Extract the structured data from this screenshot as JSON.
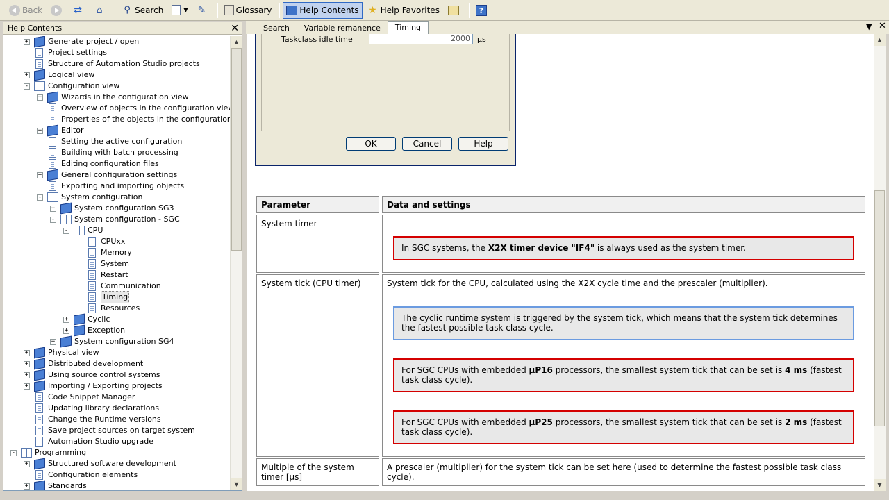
{
  "toolbar": {
    "back": "Back",
    "search": "Search",
    "glossary": "Glossary",
    "help_contents": "Help Contents",
    "help_favorites": "Help Favorites"
  },
  "left_panel": {
    "title": "Help Contents",
    "close": "✕"
  },
  "tree": [
    {
      "label": "Generate project / open",
      "level": 1,
      "icon": "book",
      "exp": "+"
    },
    {
      "label": "Project settings",
      "level": 1,
      "icon": "page"
    },
    {
      "label": "Structure of Automation Studio projects",
      "level": 1,
      "icon": "page"
    },
    {
      "label": "Logical view",
      "level": 1,
      "icon": "book",
      "exp": "+"
    },
    {
      "label": "Configuration view",
      "level": 1,
      "icon": "open",
      "exp": "-"
    },
    {
      "label": "Wizards in the configuration view",
      "level": 2,
      "icon": "book",
      "exp": "+"
    },
    {
      "label": "Overview of objects in the configuration view",
      "level": 2,
      "icon": "page"
    },
    {
      "label": "Properties of the objects in the configuration view",
      "level": 2,
      "icon": "page"
    },
    {
      "label": "Editor",
      "level": 2,
      "icon": "book",
      "exp": "+"
    },
    {
      "label": "Setting the active configuration",
      "level": 2,
      "icon": "page"
    },
    {
      "label": "Building with batch processing",
      "level": 2,
      "icon": "page"
    },
    {
      "label": "Editing configuration files",
      "level": 2,
      "icon": "page"
    },
    {
      "label": "General configuration settings",
      "level": 2,
      "icon": "book",
      "exp": "+"
    },
    {
      "label": "Exporting and importing objects",
      "level": 2,
      "icon": "page"
    },
    {
      "label": "System configuration",
      "level": 2,
      "icon": "open",
      "exp": "-"
    },
    {
      "label": "System configuration SG3",
      "level": 3,
      "icon": "book",
      "exp": "+"
    },
    {
      "label": "System configuration - SGC",
      "level": 3,
      "icon": "open",
      "exp": "-"
    },
    {
      "label": "CPU",
      "level": 4,
      "icon": "open",
      "exp": "-"
    },
    {
      "label": "CPUxx",
      "level": 5,
      "icon": "page"
    },
    {
      "label": "Memory",
      "level": 5,
      "icon": "page"
    },
    {
      "label": "System",
      "level": 5,
      "icon": "page"
    },
    {
      "label": "Restart",
      "level": 5,
      "icon": "page"
    },
    {
      "label": "Communication",
      "level": 5,
      "icon": "page"
    },
    {
      "label": "Timing",
      "level": 5,
      "icon": "page",
      "selected": true
    },
    {
      "label": "Resources",
      "level": 5,
      "icon": "page"
    },
    {
      "label": "Cyclic",
      "level": 4,
      "icon": "book",
      "exp": "+"
    },
    {
      "label": "Exception",
      "level": 4,
      "icon": "book",
      "exp": "+"
    },
    {
      "label": "System configuration SG4",
      "level": 3,
      "icon": "book",
      "exp": "+"
    },
    {
      "label": "Physical view",
      "level": 1,
      "icon": "book",
      "exp": "+"
    },
    {
      "label": "Distributed development",
      "level": 1,
      "icon": "book",
      "exp": "+"
    },
    {
      "label": "Using source control systems",
      "level": 1,
      "icon": "book",
      "exp": "+"
    },
    {
      "label": "Importing / Exporting projects",
      "level": 1,
      "icon": "book",
      "exp": "+"
    },
    {
      "label": "Code Snippet Manager",
      "level": 1,
      "icon": "page"
    },
    {
      "label": "Updating library declarations",
      "level": 1,
      "icon": "page"
    },
    {
      "label": "Change the Runtime versions",
      "level": 1,
      "icon": "page"
    },
    {
      "label": "Save project sources on target system",
      "level": 1,
      "icon": "page"
    },
    {
      "label": "Automation Studio upgrade",
      "level": 1,
      "icon": "page"
    },
    {
      "label": "Programming",
      "level": 0,
      "icon": "open",
      "exp": "-"
    },
    {
      "label": "Structured software development",
      "level": 1,
      "icon": "book",
      "exp": "+"
    },
    {
      "label": "Configuration elements",
      "level": 1,
      "icon": "page"
    },
    {
      "label": "Standards",
      "level": 1,
      "icon": "book",
      "exp": "+"
    }
  ],
  "tabs": [
    "Search",
    "Variable remanence",
    "Timing"
  ],
  "dialog": {
    "label": "Taskclass idle time",
    "value": "2000",
    "unit": "µs",
    "ok": "OK",
    "cancel": "Cancel",
    "help": "Help"
  },
  "table": {
    "headers": [
      "Parameter",
      "Data and settings"
    ],
    "system_timer": {
      "param": "System timer",
      "note_pre": "In SGC systems, the ",
      "note_bold": "X2X timer device \"IF4\"",
      "note_post": " is always used as the system timer."
    },
    "system_tick": {
      "param": "System tick (CPU timer)",
      "desc": "System tick for the CPU, calculated using the X2X cycle time and the prescaler (multiplier).",
      "info": "The cyclic runtime system is triggered by the system tick, which means that the system tick determines the fastest possible task class cycle.",
      "w1_pre": "For SGC CPUs with embedded ",
      "w1_bold1": "µP16",
      "w1_mid": " processors, the smallest system tick that can be set is ",
      "w1_bold2": "4 ms",
      "w1_post": " (fastest task class cycle).",
      "w2_pre": "For SGC CPUs with embedded ",
      "w2_bold1": "µP25",
      "w2_mid": " processors, the smallest system tick that can be set is ",
      "w2_bold2": "2 ms",
      "w2_post": " (fastest task class cycle)."
    },
    "multiple": {
      "param": "Multiple of the system timer [µs]",
      "desc": "A prescaler (multiplier) for the system tick can be set here (used to determine the fastest possible task class cycle)."
    }
  }
}
